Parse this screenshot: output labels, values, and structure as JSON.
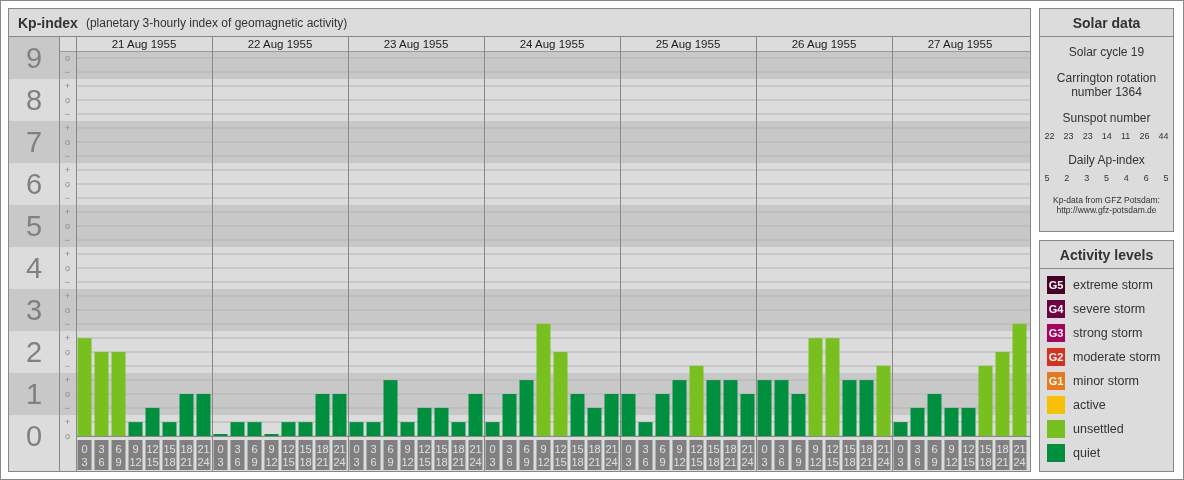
{
  "panel": {
    "title": "Kp-index",
    "subtitle": "(planetary 3-hourly index of geomagnetic activity)"
  },
  "days": [
    {
      "label": "21 Aug 1955"
    },
    {
      "label": "22 Aug 1955"
    },
    {
      "label": "23 Aug 1955"
    },
    {
      "label": "24 Aug 1955"
    },
    {
      "label": "25 Aug 1955"
    },
    {
      "label": "26 Aug 1955"
    },
    {
      "label": "27 Aug 1955"
    }
  ],
  "minor_tick_labels": [
    "o",
    "−",
    "+",
    "o",
    "−",
    "+",
    "o",
    "−",
    "+",
    "o",
    "−",
    "+",
    "o",
    "−",
    "+",
    "o",
    "−",
    "+",
    "o",
    "−",
    "+",
    "o",
    "−",
    "+",
    "o",
    "−",
    "+",
    "o"
  ],
  "chart_data": {
    "type": "bar",
    "stacked": true,
    "grid": true,
    "ylim": [
      0,
      9
    ],
    "yticks": [
      0,
      1,
      2,
      3,
      4,
      5,
      6,
      7,
      8,
      9
    ],
    "categories": [
      "0\n3",
      "3\n6",
      "6\n9",
      "9\n12",
      "12\n15",
      "15\n18",
      "18\n21",
      "21\n24",
      "0\n3",
      "3\n6",
      "6\n9",
      "9\n12",
      "12\n15",
      "15\n18",
      "18\n21",
      "21\n24",
      "0\n3",
      "3\n6",
      "6\n9",
      "9\n12",
      "12\n15",
      "15\n18",
      "18\n21",
      "21\n24",
      "0\n3",
      "3\n6",
      "6\n9",
      "9\n12",
      "12\n15",
      "15\n18",
      "18\n21",
      "21\n24",
      "0\n3",
      "3\n6",
      "6\n9",
      "9\n12",
      "12\n15",
      "15\n18",
      "18\n21",
      "21\n24",
      "0\n3",
      "3\n6",
      "6\n9",
      "9\n12",
      "12\n15",
      "15\n18",
      "18\n21",
      "21\n24",
      "0\n3",
      "3\n6",
      "6\n9",
      "9\n12",
      "12\n15",
      "15\n18",
      "18\n21",
      "21\n24"
    ],
    "series": [
      {
        "color": "#008f3f",
        "values": [
          null,
          null,
          null,
          0.33,
          0.67,
          0.33,
          1,
          1,
          0,
          0.33,
          0.33,
          0,
          0.33,
          0.33,
          1,
          1,
          0.33,
          0.33,
          1.33,
          0.33,
          0.67,
          0.67,
          0.33,
          1,
          0.33,
          1,
          1.33,
          null,
          null,
          1,
          0.67,
          1,
          1,
          0.33,
          1,
          1.33,
          null,
          1.33,
          1.33,
          1,
          1.33,
          1.33,
          1,
          null,
          null,
          1.33,
          1.33,
          null,
          0.33,
          0.67,
          1,
          0.67,
          0.67,
          null,
          null,
          null
        ]
      },
      {
        "color": "#78c020",
        "values": [
          2.33,
          2,
          2,
          null,
          null,
          null,
          null,
          null,
          null,
          null,
          null,
          null,
          null,
          null,
          null,
          null,
          null,
          null,
          null,
          null,
          null,
          null,
          null,
          null,
          null,
          null,
          null,
          2.67,
          2,
          null,
          null,
          null,
          null,
          null,
          null,
          null,
          1.67,
          null,
          null,
          null,
          null,
          null,
          null,
          2.33,
          2.33,
          null,
          null,
          1.67,
          null,
          null,
          null,
          null,
          null,
          1.67,
          2,
          2.67
        ]
      }
    ]
  },
  "solar_data": {
    "title": "Solar data",
    "cycle": "Solar cycle 19",
    "carrington": [
      "Carrington rotation",
      "number 1364"
    ],
    "sunspot_label": "Sunspot number",
    "sunspot_numbers": [
      "22",
      "23",
      "23",
      "14",
      "11",
      "26",
      "44"
    ],
    "ap_label": "Daily Ap-index",
    "ap_values": [
      "5",
      "2",
      "3",
      "5",
      "4",
      "6",
      "5"
    ],
    "source": [
      "Kp-data from GFZ Potsdam:",
      "http://www.gfz-potsdam.de"
    ]
  },
  "activity_levels": {
    "title": "Activity levels",
    "items": [
      {
        "badge": "G5",
        "label": "extreme storm",
        "color": "#4a0026"
      },
      {
        "badge": "G4",
        "label": "severe storm",
        "color": "#6d0040"
      },
      {
        "badge": "G3",
        "label": "strong storm",
        "color": "#a8005e"
      },
      {
        "badge": "G2",
        "label": "moderate storm",
        "color": "#d8301e"
      },
      {
        "badge": "G1",
        "label": "minor storm",
        "color": "#e8781a"
      },
      {
        "label": "active",
        "color": "#f8c000"
      },
      {
        "label": "unsettled",
        "color": "#78c020"
      },
      {
        "label": "quiet",
        "color": "#008f3f"
      }
    ]
  }
}
